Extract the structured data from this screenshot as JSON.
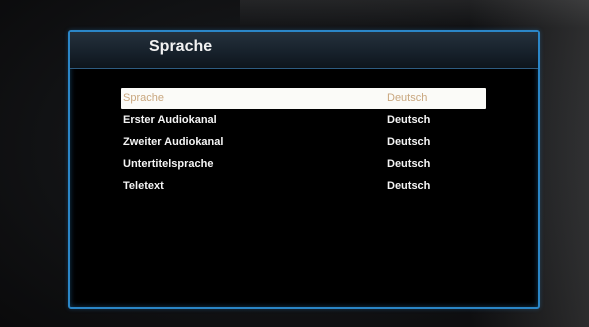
{
  "menu": {
    "title": "Sprache"
  },
  "settings": [
    {
      "label": "Sprache",
      "value": "Deutsch",
      "selected": true
    },
    {
      "label": "Erster Audiokanal",
      "value": "Deutsch",
      "selected": false
    },
    {
      "label": "Zweiter Audiokanal",
      "value": "Deutsch",
      "selected": false
    },
    {
      "label": "Untertitelsprache",
      "value": "Deutsch",
      "selected": false
    },
    {
      "label": "Teletext",
      "value": "Deutsch",
      "selected": false
    }
  ],
  "colors": {
    "panel_border": "#2b86c7",
    "selected_row_bg": "#fbfbf8",
    "selected_row_text": "#c9a77f",
    "row_text": "#f4f4f4"
  }
}
